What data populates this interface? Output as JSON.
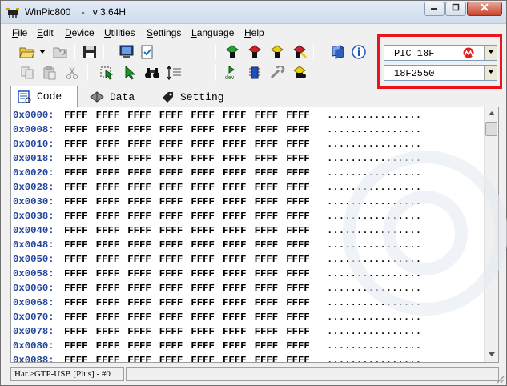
{
  "window": {
    "title": "WinPic800    -   v 3.64H"
  },
  "menu": [
    {
      "label": "File",
      "key": "F",
      "rest": "ile"
    },
    {
      "label": "Edit",
      "key": "E",
      "rest": "dit"
    },
    {
      "label": "Device",
      "key": "D",
      "rest": "evice"
    },
    {
      "label": "Utilities",
      "key": "U",
      "rest": "tilities"
    },
    {
      "label": "Settings",
      "key": "S",
      "rest": "ettings"
    },
    {
      "label": "Language",
      "key": "L",
      "rest": "anguage"
    },
    {
      "label": "Help",
      "key": "H",
      "rest": "elp"
    }
  ],
  "device": {
    "family": "PIC 18F",
    "model": "18F2550",
    "highlight_color": "#e8151f"
  },
  "tabs": [
    {
      "label": "Code",
      "icon": "code-page-icon",
      "active": true
    },
    {
      "label": "Data",
      "icon": "data-chip-icon",
      "active": false
    },
    {
      "label": "Setting",
      "icon": "setting-tag-icon",
      "active": false
    }
  ],
  "code": {
    "addresses": [
      "0x0000:",
      "0x0008:",
      "0x0010:",
      "0x0018:",
      "0x0020:",
      "0x0028:",
      "0x0030:",
      "0x0038:",
      "0x0040:",
      "0x0048:",
      "0x0050:",
      "0x0058:",
      "0x0060:",
      "0x0068:",
      "0x0070:",
      "0x0078:",
      "0x0080:",
      "0x0088:"
    ],
    "word": "FFFF",
    "words_per_row": 8,
    "ascii": "................",
    "address_color": "#23459c"
  },
  "status": {
    "hardware": "Har.>GTP-USB [Plus] - #0"
  }
}
